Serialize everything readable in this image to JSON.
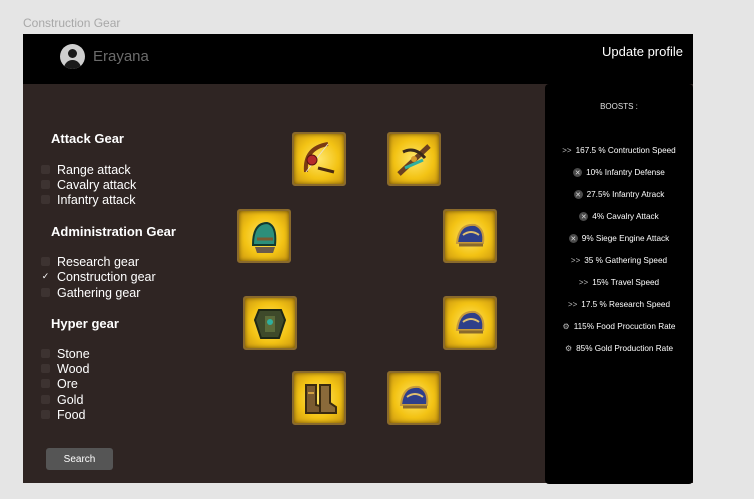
{
  "frame_title": "Construction Gear",
  "header": {
    "username": "Erayana",
    "update_profile": "Update profile"
  },
  "sections": [
    {
      "title": "Attack Gear",
      "items": [
        {
          "label": "Range attack",
          "checked": false
        },
        {
          "label": "Cavalry attack",
          "checked": false
        },
        {
          "label": "Infantry attack",
          "checked": false
        }
      ]
    },
    {
      "title": "Administration Gear",
      "items": [
        {
          "label": "Research gear",
          "checked": false
        },
        {
          "label": "Construction gear",
          "checked": true
        },
        {
          "label": "Gathering gear",
          "checked": false
        }
      ]
    },
    {
      "title": "Hyper gear",
      "items": [
        {
          "label": "Stone",
          "checked": false
        },
        {
          "label": "Wood",
          "checked": false
        },
        {
          "label": "Ore",
          "checked": false
        },
        {
          "label": "Gold",
          "checked": false
        },
        {
          "label": "Food",
          "checked": false
        }
      ]
    }
  ],
  "search_label": "Search",
  "gear_items": [
    {
      "icon": "bow-gear-icon"
    },
    {
      "icon": "crossbow-gear-icon"
    },
    {
      "icon": "helmet-green-gear-icon"
    },
    {
      "icon": "helmet-blue-gear-icon"
    },
    {
      "icon": "armor-gear-icon"
    },
    {
      "icon": "helmet-blue-gear-icon"
    },
    {
      "icon": "boots-gear-icon"
    },
    {
      "icon": "helmet-blue-gear-icon"
    }
  ],
  "boosts": {
    "title": "BOOSTS :",
    "items": [
      {
        "icon": "chevrons-icon",
        "text": "167.5 % Contruction Speed"
      },
      {
        "icon": "close-circle-icon",
        "text": "10% Infantry Defense"
      },
      {
        "icon": "close-circle-icon",
        "text": "27.5% Infantry Atrack"
      },
      {
        "icon": "close-circle-icon",
        "text": "4% Cavalry Attack"
      },
      {
        "icon": "close-circle-icon",
        "text": "9% Siege Engine Attack"
      },
      {
        "icon": "chevrons-icon",
        "text": "35 % Gathering Speed"
      },
      {
        "icon": "chevrons-icon",
        "text": "15% Travel Speed"
      },
      {
        "icon": "chevrons-icon",
        "text": "17.5 % Research Speed"
      },
      {
        "icon": "resource-icon",
        "text": "115% Food Procuction Rate"
      },
      {
        "icon": "resource-icon",
        "text": "85% Gold Production Rate"
      }
    ]
  },
  "colors": {
    "panel": "#2f2523",
    "header": "#000000",
    "accent_gold": "#f3c314",
    "button": "#555555"
  }
}
